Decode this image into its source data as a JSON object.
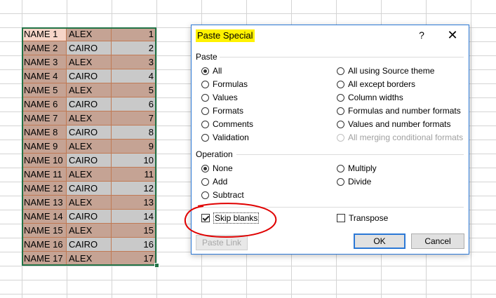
{
  "sheet": {
    "rows": [
      {
        "name": "NAME 1",
        "city": "ALEX",
        "num": "1"
      },
      {
        "name": "NAME 2",
        "city": "CAIRO",
        "num": "2"
      },
      {
        "name": "NAME 3",
        "city": "ALEX",
        "num": "3"
      },
      {
        "name": "NAME 4",
        "city": "CAIRO",
        "num": "4"
      },
      {
        "name": "NAME 5",
        "city": "ALEX",
        "num": "5"
      },
      {
        "name": "NAME 6",
        "city": "CAIRO",
        "num": "6"
      },
      {
        "name": "NAME 7",
        "city": "ALEX",
        "num": "7"
      },
      {
        "name": "NAME 8",
        "city": "CAIRO",
        "num": "8"
      },
      {
        "name": "NAME 9",
        "city": "ALEX",
        "num": "9"
      },
      {
        "name": "NAME 10",
        "city": "CAIRO",
        "num": "10"
      },
      {
        "name": "NAME 11",
        "city": "ALEX",
        "num": "11"
      },
      {
        "name": "NAME 12",
        "city": "CAIRO",
        "num": "12"
      },
      {
        "name": "NAME 13",
        "city": "ALEX",
        "num": "13"
      },
      {
        "name": "NAME 14",
        "city": "CAIRO",
        "num": "14"
      },
      {
        "name": "NAME 15",
        "city": "ALEX",
        "num": "15"
      },
      {
        "name": "NAME 16",
        "city": "CAIRO",
        "num": "16"
      },
      {
        "name": "NAME 17",
        "city": "ALEX",
        "num": "17"
      }
    ],
    "colors": {
      "selection_border": "#217346",
      "cell_fill": "#c5a394",
      "alt_fill": "#c9c9c9",
      "active_cell": "#f6d5c8"
    }
  },
  "dialog": {
    "title": "Paste Special",
    "help": "?",
    "close": "✕",
    "paste_label": "Paste",
    "paste_left": [
      {
        "label": "All",
        "checked": true
      },
      {
        "label": "Formulas",
        "checked": false
      },
      {
        "label": "Values",
        "checked": false
      },
      {
        "label": "Formats",
        "checked": false
      },
      {
        "label": "Comments",
        "checked": false
      },
      {
        "label": "Validation",
        "checked": false
      }
    ],
    "paste_right": [
      {
        "label": "All using Source theme",
        "checked": false,
        "disabled": false
      },
      {
        "label": "All except borders",
        "checked": false,
        "disabled": false
      },
      {
        "label": "Column widths",
        "checked": false,
        "disabled": false
      },
      {
        "label": "Formulas and number formats",
        "checked": false,
        "disabled": false
      },
      {
        "label": "Values and number formats",
        "checked": false,
        "disabled": false
      },
      {
        "label": "All merging conditional formats",
        "checked": false,
        "disabled": true
      }
    ],
    "operation_label": "Operation",
    "operation_left": [
      {
        "label": "None",
        "checked": true
      },
      {
        "label": "Add",
        "checked": false
      },
      {
        "label": "Subtract",
        "checked": false
      }
    ],
    "operation_right": [
      {
        "label": "Multiply",
        "checked": false
      },
      {
        "label": "Divide",
        "checked": false
      }
    ],
    "skip_blanks": {
      "label": "Skip blanks",
      "checked": true
    },
    "transpose": {
      "label": "Transpose",
      "checked": false
    },
    "paste_link_label": "Paste Link",
    "ok_label": "OK",
    "cancel_label": "Cancel",
    "colors": {
      "title_highlight": "#fff200",
      "accent": "#2b78d6",
      "annotation": "#e00000"
    }
  }
}
